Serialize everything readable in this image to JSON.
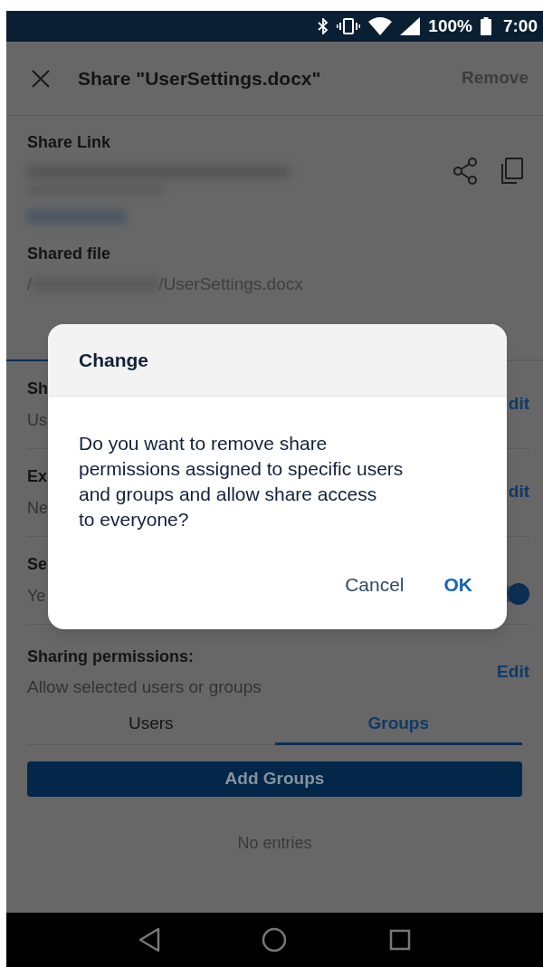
{
  "status_bar": {
    "battery": "100%",
    "time": "7:00"
  },
  "app_bar": {
    "title": "Share \"UserSettings.docx\"",
    "action": "Remove"
  },
  "share_link": {
    "label": "Share Link"
  },
  "shared_file": {
    "label": "Shared file",
    "path_start": "/",
    "path_end": "/UserSettings.docx"
  },
  "settings_rows": [
    {
      "kind": "edit",
      "label": "Sh",
      "value": "Us",
      "action": "dit"
    },
    {
      "kind": "edit",
      "label": "Ex",
      "value": "Ne",
      "action": "dit"
    },
    {
      "kind": "toggle",
      "label": "Se",
      "value": "Ye",
      "on": true
    }
  ],
  "sharing_permissions": {
    "label": "Sharing permissions:",
    "value": "Allow selected users or groups",
    "action": "Edit"
  },
  "tabs": [
    {
      "label": "Users",
      "selected": false
    },
    {
      "label": "Groups",
      "selected": true
    }
  ],
  "add_button": "Add Groups",
  "empty_text": "No entries",
  "dialog": {
    "title": "Change",
    "message": "Do you want to remove share\npermissions assigned to specific users\nand groups and allow share access\nto everyone?",
    "buttons": [
      {
        "label": "Cancel",
        "kind": "secondary"
      },
      {
        "label": "OK",
        "kind": "primary"
      }
    ]
  }
}
